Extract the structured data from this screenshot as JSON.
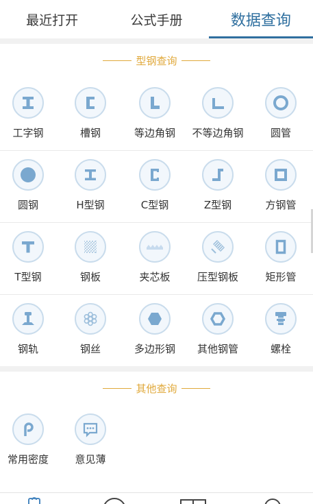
{
  "tabs": [
    {
      "label": "最近打开",
      "active": false
    },
    {
      "label": "公式手册",
      "active": false
    },
    {
      "label": "数据查询",
      "active": true
    }
  ],
  "sections": {
    "steel": {
      "title": "型钢查询"
    },
    "other": {
      "title": "其他查询"
    }
  },
  "steel_items": [
    {
      "label": "工字钢",
      "icon": "i-beam-icon"
    },
    {
      "label": "槽钢",
      "icon": "channel-steel-icon"
    },
    {
      "label": "等边角钢",
      "icon": "equal-angle-icon"
    },
    {
      "label": "不等边角钢",
      "icon": "unequal-angle-icon"
    },
    {
      "label": "圆管",
      "icon": "round-pipe-icon"
    },
    {
      "label": "圆钢",
      "icon": "round-bar-icon"
    },
    {
      "label": "H型钢",
      "icon": "h-beam-icon"
    },
    {
      "label": "C型钢",
      "icon": "c-section-icon"
    },
    {
      "label": "Z型钢",
      "icon": "z-section-icon"
    },
    {
      "label": "方钢管",
      "icon": "square-pipe-icon"
    },
    {
      "label": "T型钢",
      "icon": "t-section-icon"
    },
    {
      "label": "钢板",
      "icon": "steel-plate-icon"
    },
    {
      "label": "夹芯板",
      "icon": "sandwich-panel-icon"
    },
    {
      "label": "压型钢板",
      "icon": "profiled-sheet-icon"
    },
    {
      "label": "矩形管",
      "icon": "rectangular-pipe-icon"
    },
    {
      "label": "钢轨",
      "icon": "rail-icon"
    },
    {
      "label": "钢丝",
      "icon": "steel-wire-icon"
    },
    {
      "label": "多边形钢",
      "icon": "polygon-steel-icon"
    },
    {
      "label": "其他钢管",
      "icon": "other-pipe-icon"
    },
    {
      "label": "螺栓",
      "icon": "bolt-icon"
    }
  ],
  "other_items": [
    {
      "label": "常用密度",
      "icon": "density-icon"
    },
    {
      "label": "意见薄",
      "icon": "feedback-icon"
    }
  ],
  "bottom_nav": [
    {
      "icon": "home-icon"
    },
    {
      "icon": "compass-icon"
    },
    {
      "icon": "grid-icon"
    },
    {
      "icon": "user-icon"
    }
  ],
  "colors": {
    "accent": "#2f6f9f",
    "section_title": "#e0a83a",
    "icon_fill": "#7aa8cf",
    "icon_bg": "#f2f7fc"
  }
}
